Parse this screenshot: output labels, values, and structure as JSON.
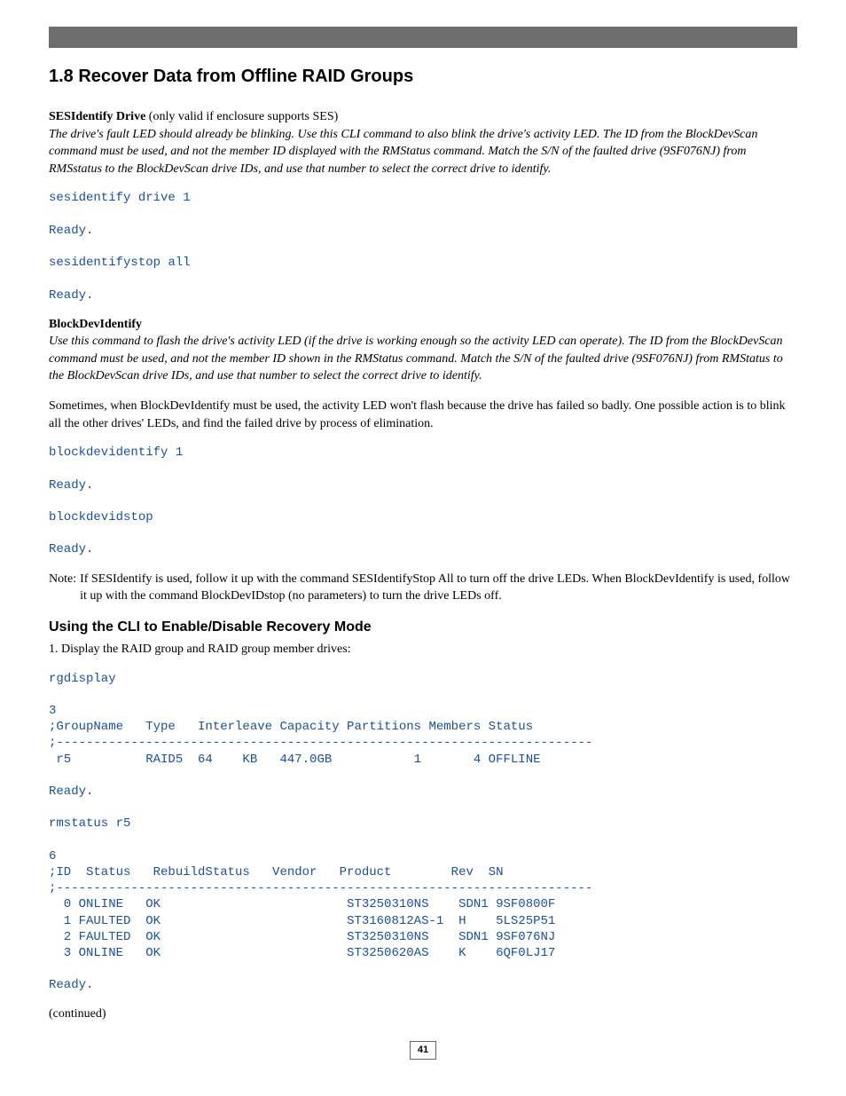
{
  "section_title": "1.8 Recover Data from Offline RAID Groups",
  "ses_label": "SESIdentify Drive",
  "ses_paren": " (only valid if enclosure supports SES)",
  "ses_italic": "The drive's fault LED should already be blinking. Use this CLI command to also blink the drive's activity LED. The ID from the BlockDevScan command must be used, and not the member ID displayed with the RMStatus command. Match the S/N of the faulted drive (9SF076NJ) from RMSstatus to the BlockDevScan drive IDs, and use that number to select the correct drive to identify.",
  "code1": "sesidentify drive 1\n\nReady.\n\nsesidentifystop all\n\nReady.",
  "bdi_label": "BlockDevIdentify",
  "bdi_italic": "Use this command to flash the drive's activity LED (if the drive is working enough so the activity LED can operate). The ID from the BlockDevScan command must be used, and not the member ID shown in the RMStatus command. Match the S/N of the faulted drive (9SF076NJ) from RMStatus to the BlockDevScan drive IDs, and use that number to select the correct drive to identify.",
  "bdi_para": "Sometimes, when BlockDevIdentify must be used, the activity LED won't flash because the drive has failed so badly. One possible action is to blink all the other drives' LEDs, and find the failed drive by process of elimination.",
  "code2": "blockdevidentify 1\n\nReady.\n\nblockdevidstop\n\nReady.",
  "note_label": "Note: ",
  "note_body": "If SESIdentify is used, follow it up with the command SESIdentifyStop All to turn off the drive LEDs. When BlockDevIdentify is used, follow it up with the command BlockDevIDstop (no parameters) to turn the drive LEDs off.",
  "subheading": "Using the CLI to Enable/Disable Recovery Mode",
  "step1": "1. Display the RAID group and RAID group member drives:",
  "code3": "rgdisplay\n\n3\n;GroupName   Type   Interleave Capacity Partitions Members Status\n;------------------------------------------------------------------------\n r5          RAID5  64    KB   447.0GB           1       4 OFFLINE\n\nReady.\n\nrmstatus r5\n\n6\n;ID  Status   RebuildStatus   Vendor   Product        Rev  SN\n;------------------------------------------------------------------------\n  0 ONLINE   OK                         ST3250310NS    SDN1 9SF0800F\n  1 FAULTED  OK                         ST3160812AS-1  H    5LS25P51\n  2 FAULTED  OK                         ST3250310NS    SDN1 9SF076NJ\n  3 ONLINE   OK                         ST3250620AS    K    6QF0LJ17\n\nReady.",
  "continued": "(continued)",
  "page_number": "41"
}
